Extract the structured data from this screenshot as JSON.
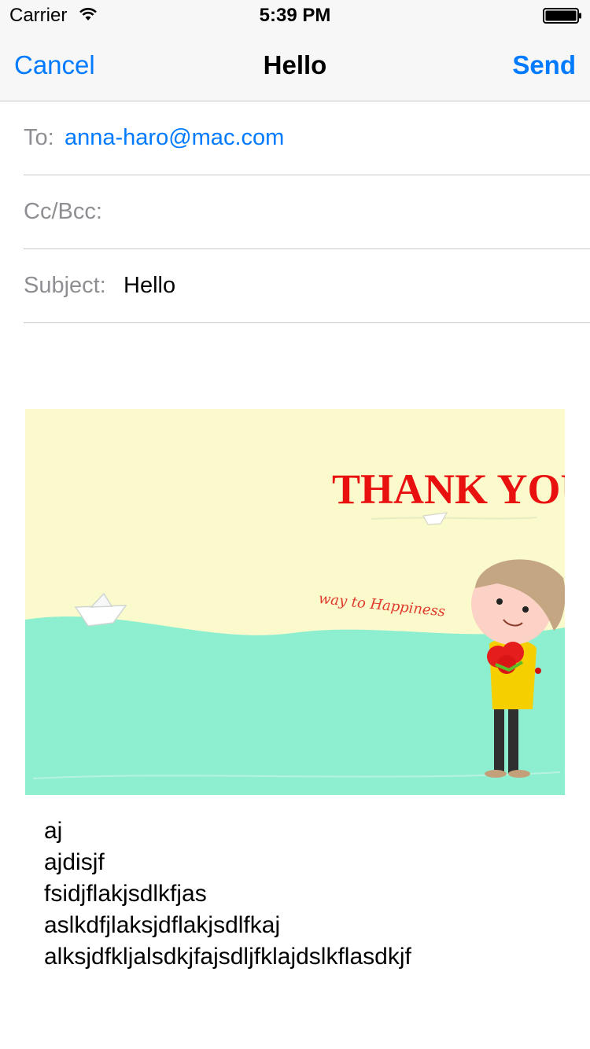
{
  "status_bar": {
    "carrier": "Carrier",
    "time": "5:39 PM",
    "wifi_icon": "wifi-icon",
    "battery_icon": "battery-icon"
  },
  "nav": {
    "cancel_label": "Cancel",
    "title": "Hello",
    "send_label": "Send",
    "accent_color": "#007aff"
  },
  "fields": {
    "to_label": "To:",
    "to_value": "anna-haro@mac.com",
    "cc_label": "Cc/Bcc:",
    "subject_label": "Subject:",
    "subject_value": "Hello"
  },
  "attachment": {
    "headline": "THANK YOU",
    "tagline": "way to Happiness"
  },
  "body": {
    "lines": [
      "aj",
      "ajdisjf",
      "fsidjflakjsdlkfjas",
      "aslkdfjlaksjdflakjsdlfkaj",
      "alksjdfkljalsdkjfajsdljfklajdslkflasdkjf"
    ]
  }
}
